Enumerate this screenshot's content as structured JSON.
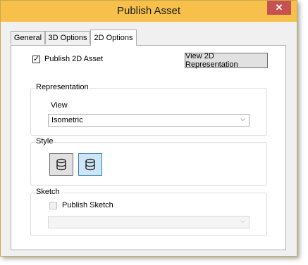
{
  "window": {
    "title": "Publish Asset"
  },
  "title_bar": {
    "close_glyph": "✕",
    "close_color": "#c75050",
    "bar_color": "#f6c04a"
  },
  "tabs": [
    {
      "label": "General",
      "active": false
    },
    {
      "label": "3D Options",
      "active": false
    },
    {
      "label": "2D Options",
      "active": true
    }
  ],
  "publish2d": {
    "label": "Publish 2D Asset",
    "checked": true,
    "check_glyph": "✓"
  },
  "view2d_button": {
    "label": "View 2D Representation"
  },
  "representation": {
    "legend": "Representation",
    "view_label": "View",
    "view_value": "Isometric",
    "dropdown_glyph": "⌵"
  },
  "style": {
    "legend": "Style",
    "options": [
      {
        "icon": "cylinder-shaded-icon",
        "selected": false
      },
      {
        "icon": "cylinder-outline-icon",
        "selected": true
      }
    ]
  },
  "sketch": {
    "legend": "Sketch",
    "publish_label": "Publish Sketch",
    "checked": false,
    "select_value": "",
    "dropdown_glyph": "⌵",
    "enabled": false
  }
}
